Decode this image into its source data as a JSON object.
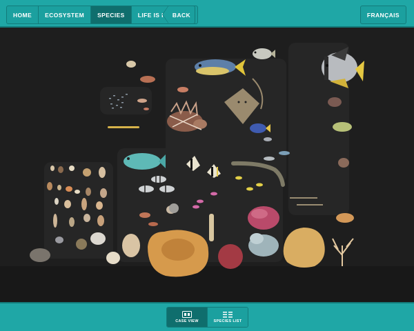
{
  "nav": {
    "tabs": [
      {
        "label": "HOME",
        "active": false
      },
      {
        "label": "ECOSYSTEM",
        "active": false
      },
      {
        "label": "SPECIES",
        "active": true
      },
      {
        "label": "LIFE IS IN CRISIS",
        "active": false
      }
    ],
    "back_label": "BACK",
    "language_label": "FRANÇAIS"
  },
  "view_toggle": {
    "case_view_label": "CASE VIEW",
    "species_list_label": "SPECIES LIST",
    "active": "case-view"
  },
  "colors": {
    "bar": "#1fa7a6",
    "bar_border": "#137b7a",
    "active_tab": "#0f6e6d",
    "background": "#1c1c1c"
  },
  "icons": {
    "case_view": "case-view-icon",
    "species_list": "list-icon"
  }
}
